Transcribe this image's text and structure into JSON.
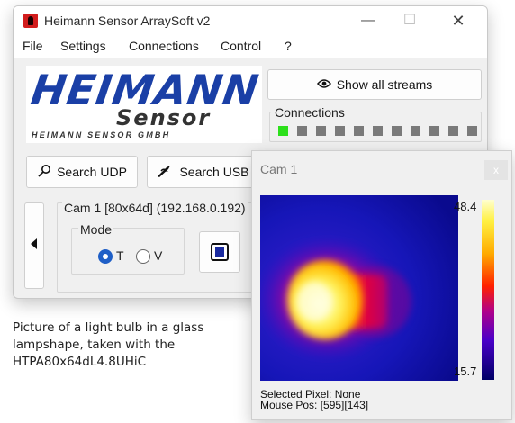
{
  "main_window": {
    "title": "Heimann Sensor ArraySoft v2",
    "controls": {
      "minimize": "—",
      "maximize": "☐",
      "close": "✕"
    },
    "menu": [
      "File",
      "Settings",
      "Connections",
      "Control",
      "?"
    ],
    "logo": {
      "brand": "HEIMANN",
      "product": "Sensor",
      "company": "HEIMANN SENSOR GMBH"
    },
    "show_streams_label": "Show all streams",
    "connections_label": "Connections",
    "connections": [
      {
        "status": "connected"
      },
      {
        "status": "idle"
      },
      {
        "status": "idle"
      },
      {
        "status": "idle"
      },
      {
        "status": "idle"
      },
      {
        "status": "idle"
      },
      {
        "status": "idle"
      },
      {
        "status": "idle"
      },
      {
        "status": "idle"
      },
      {
        "status": "idle"
      },
      {
        "status": "idle"
      }
    ],
    "search_udp_label": "Search UDP",
    "search_usb_label": "Search USB",
    "camera_group_title": "Cam 1 [80x64d] (192.168.0.192)",
    "mode_label": "Mode",
    "mode_options": [
      {
        "label": "T",
        "selected": true
      },
      {
        "label": "V",
        "selected": false
      }
    ],
    "colors": {
      "connected": "#2de01c",
      "idle": "#7a7a7a",
      "radio_accent": "#1f5fc7"
    }
  },
  "caption": "Picture of a light bulb in a glass lampshape, taken with the HTPA80x64dL4.8UHiC",
  "cam_window": {
    "title": "Cam 1",
    "close_label": "x",
    "scale_max": "48.4",
    "scale_min": "15.7",
    "selected_pixel": "Selected Pixel: None",
    "mouse_pos": "Mouse Pos: [595][143]"
  }
}
